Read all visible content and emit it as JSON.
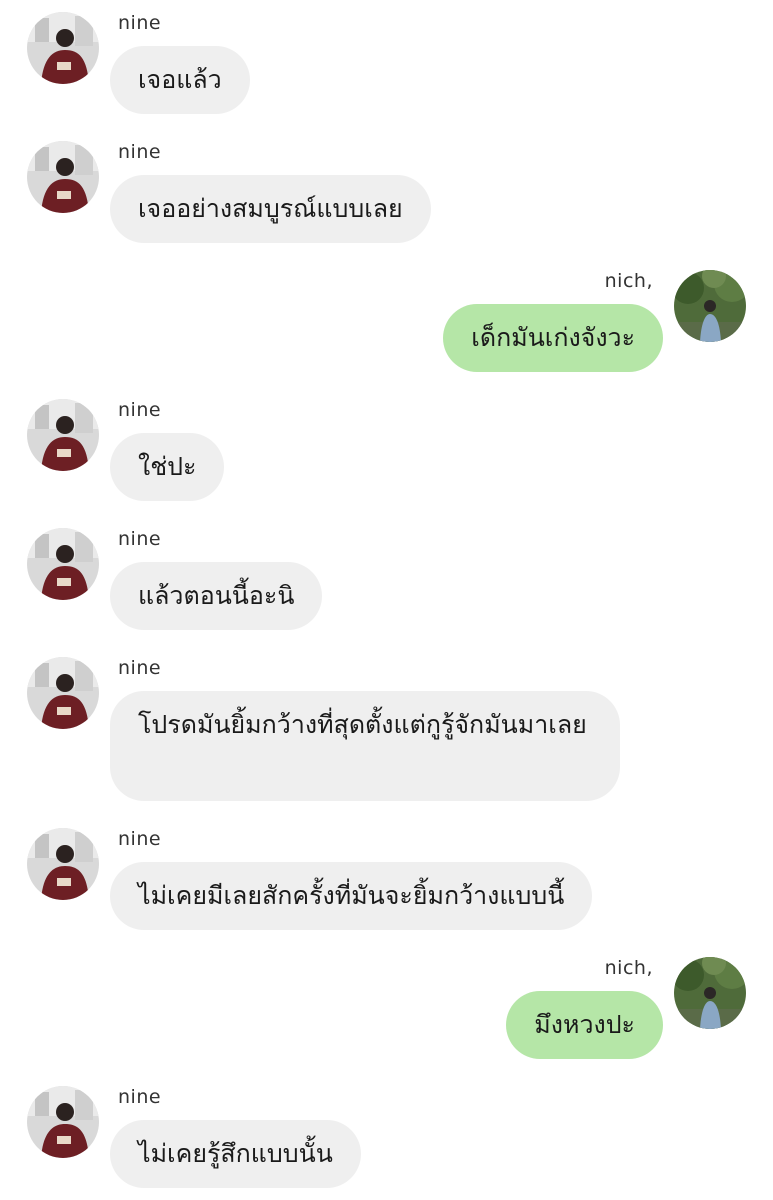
{
  "messages": [
    {
      "sender": "nine",
      "side": "left",
      "text": "เจอแล้ว"
    },
    {
      "sender": "nine",
      "side": "left",
      "text": "เจออย่างสมบูรณ์แบบเลย"
    },
    {
      "sender": "nich,",
      "side": "right",
      "text": "เด็กมันเก่งจังวะ"
    },
    {
      "sender": "nine",
      "side": "left",
      "text": "ใช่ปะ"
    },
    {
      "sender": "nine",
      "side": "left",
      "text": "แล้วตอนนี้อะนิ"
    },
    {
      "sender": "nine",
      "side": "left",
      "text": "โปรดมันยิ้มกว้างที่สุดตั้งแต่กูรู้จักมันมาเลย"
    },
    {
      "sender": "nine",
      "side": "left",
      "text": "ไม่เคยมีเลยสักครั้งที่มันจะยิ้มกว้างแบบนี้"
    },
    {
      "sender": "nich,",
      "side": "right",
      "text": "มึงหวงปะ"
    },
    {
      "sender": "nine",
      "side": "left",
      "text": "ไม่เคยรู้สึกแบบนั้น"
    }
  ],
  "icons": {
    "left_avatar": "avatar-photo-person-maroon-hoodie",
    "right_avatar": "avatar-photo-person-trees"
  },
  "colors": {
    "incoming_bubble": "#efefef",
    "outgoing_bubble": "#b5e6a7",
    "background": "#ffffff",
    "text": "#1a1a1a"
  }
}
